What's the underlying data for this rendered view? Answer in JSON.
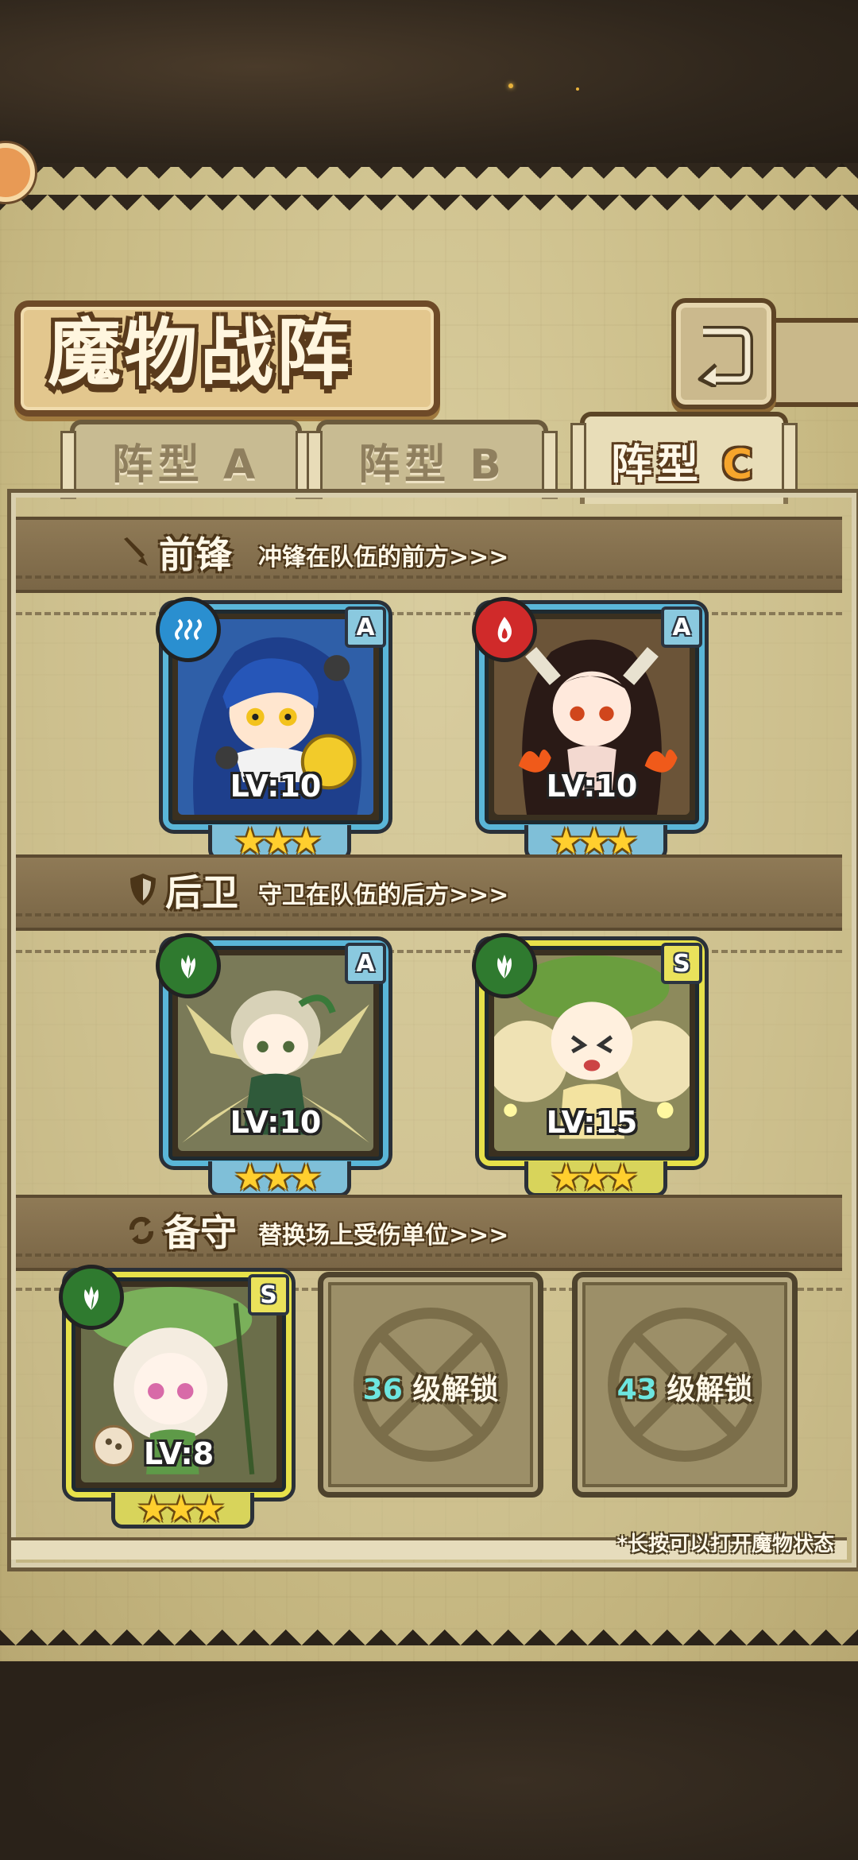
{
  "header": {
    "title": "魔物战阵",
    "return_icon": "return-arrow-icon"
  },
  "tabs": [
    {
      "label": "阵型",
      "suffix": "A",
      "active": false
    },
    {
      "label": "阵型",
      "suffix": "B",
      "active": false
    },
    {
      "label": "阵型",
      "suffix": "C",
      "active": true
    }
  ],
  "sections": {
    "vanguard": {
      "title": "前锋",
      "subtitle": "冲锋在队伍的前方>>>",
      "icon": "sword-icon"
    },
    "rear": {
      "title": "后卫",
      "subtitle": "守卫在队伍的后方>>>",
      "icon": "shield-icon"
    },
    "reserve": {
      "title": "备守",
      "subtitle": "替换场上受伤单位>>>",
      "icon": "swap-icon"
    }
  },
  "monsters": {
    "vanguard_1": {
      "element": "water",
      "rank": "A",
      "level": "LV:10",
      "stars": 3
    },
    "vanguard_2": {
      "element": "fire",
      "rank": "A",
      "level": "LV:10",
      "stars": 3
    },
    "rear_1": {
      "element": "grass",
      "rank": "A",
      "level": "LV:10",
      "stars": 3
    },
    "rear_2": {
      "element": "grass",
      "rank": "S",
      "level": "LV:15",
      "stars": 3
    },
    "reserve_1": {
      "element": "grass",
      "rank": "S",
      "level": "LV:8",
      "stars": 3
    }
  },
  "locked_slots": [
    {
      "level": "36",
      "text": "级解锁"
    },
    {
      "level": "43",
      "text": "级解锁"
    }
  ],
  "footnote": "*长按可以打开魔物状态",
  "colors": {
    "rank_a": "#5ab6d8",
    "rank_s": "#e6e14a",
    "water": "#2a8fd0",
    "fire": "#d02a2a",
    "grass": "#2f7a2f",
    "star": "#ffcf2e"
  }
}
